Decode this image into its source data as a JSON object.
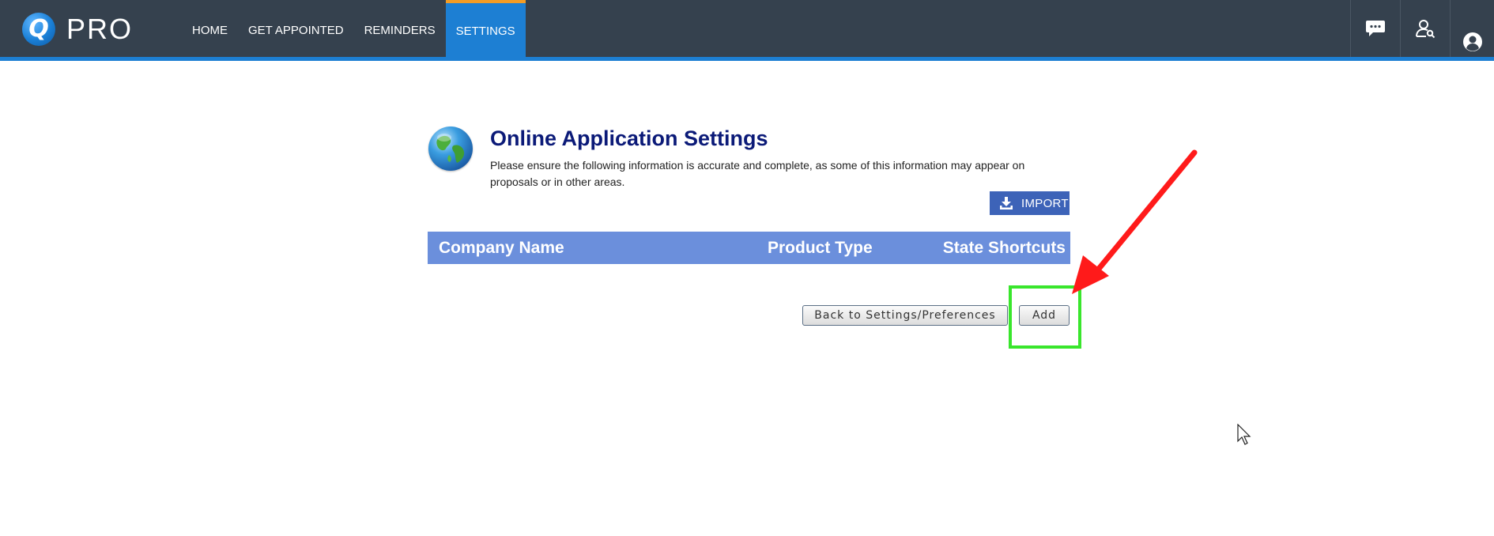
{
  "app": {
    "logo_letter": "Q",
    "logo_text": "PRO"
  },
  "nav": {
    "items": [
      {
        "label": "HOME",
        "active": false
      },
      {
        "label": "GET APPOINTED",
        "active": false
      },
      {
        "label": "REMINDERS",
        "active": false
      },
      {
        "label": "SETTINGS",
        "active": true
      }
    ],
    "icons": [
      "chat-icon",
      "user-search-icon",
      "account-icon"
    ]
  },
  "page": {
    "title": "Online Application Settings",
    "description": "Please ensure the following information is accurate and complete, as some of this information may appear on proposals or in other areas.",
    "import_label": "IMPORT"
  },
  "table": {
    "columns": [
      "Company Name",
      "Product Type",
      "State Shortcuts"
    ],
    "rows": []
  },
  "actions": {
    "back_label": "Back to Settings/Preferences",
    "add_label": "Add"
  },
  "colors": {
    "nav_bg": "#35414e",
    "nav_active": "#1d7fd3",
    "nav_active_top": "#f39c25",
    "title": "#0b1a78",
    "table_header": "#6b8fdc",
    "import_button": "#3d63b8",
    "highlight_box": "#39e62c",
    "annotation_arrow": "#ff1a1a"
  }
}
